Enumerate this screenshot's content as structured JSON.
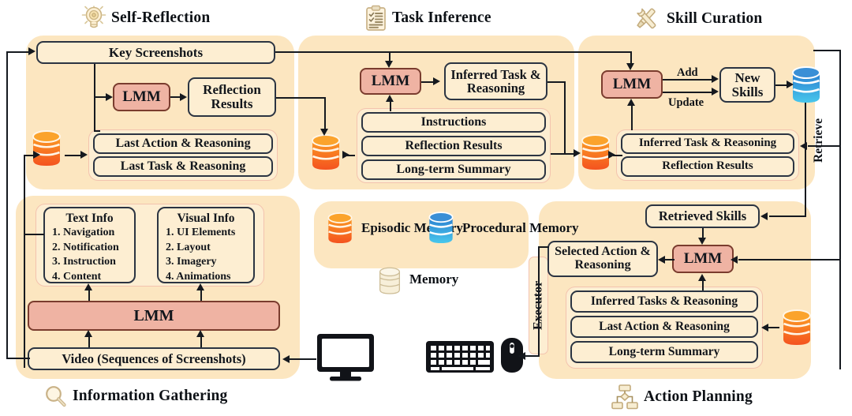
{
  "sections": {
    "self_reflection": {
      "title": "Self-Reflection",
      "icon": "lightbulb-icon",
      "key_screenshots": "Key Screenshots",
      "lmm": "LMM",
      "reflection_results": "Reflection Results",
      "last_action": "Last Action & Reasoning",
      "last_task": "Last Task & Reasoning"
    },
    "task_inference": {
      "title": "Task Inference",
      "icon": "clipboard-checklist-icon",
      "lmm": "LMM",
      "inferred_task": "Inferred Task & Reasoning",
      "instructions": "Instructions",
      "reflection_results": "Reflection Results",
      "long_term_summary": "Long-term Summary"
    },
    "skill_curation": {
      "title": "Skill Curation",
      "icon": "wrench-screwdriver-icon",
      "lmm": "LMM",
      "add_label": "Add",
      "update_label": "Update",
      "new_skills": "New Skills",
      "inferred_task": "Inferred Task & Reasoning",
      "reflection_results": "Reflection Results",
      "retrieve_label": "Retrieve"
    },
    "information_gathering": {
      "title": "Information Gathering",
      "icon": "magnifier-icon",
      "text_info": {
        "title": "Text Info",
        "items": [
          "1. Navigation",
          "2. Notification",
          "3. Instruction",
          "4. Content"
        ]
      },
      "visual_info": {
        "title": "Visual Info",
        "items": [
          "1. UI Elements",
          "2. Layout",
          "3. Imagery",
          "4. Animations"
        ]
      },
      "lmm": "LMM",
      "video": "Video (Sequences of Screenshots)"
    },
    "action_planning": {
      "title": "Action Planning",
      "icon": "flowchart-icon",
      "retrieved_skills": "Retrieved Skills",
      "lmm": "LMM",
      "selected_action": "Selected Action & Reasoning",
      "inferred_tasks": "Inferred Tasks & Reasoning",
      "last_action": "Last Action & Reasoning",
      "long_term_summary": "Long-term Summary",
      "executor_label": "Executor"
    },
    "memory_legend": {
      "episodic": "Episodic Memory",
      "procedural": "Procedural Memory",
      "memory": "Memory",
      "episodic_icon": "orange-database-icon",
      "procedural_icon": "blue-database-icon",
      "memory_icon": "beige-database-icon"
    },
    "devices": {
      "monitor_icon": "monitor-icon",
      "keyboard_icon": "keyboard-icon",
      "mouse_icon": "mouse-icon"
    }
  },
  "colors": {
    "panel_bg": "#fce6c0",
    "box_bg": "#fdeed2",
    "box_border": "#2b3442",
    "lmm_bg": "#efb3a3",
    "lmm_border": "#7a3c2e",
    "group_border": "#f3c3ae",
    "episodic": "#f97316",
    "procedural": "#2196d9",
    "line": "#15191f"
  }
}
